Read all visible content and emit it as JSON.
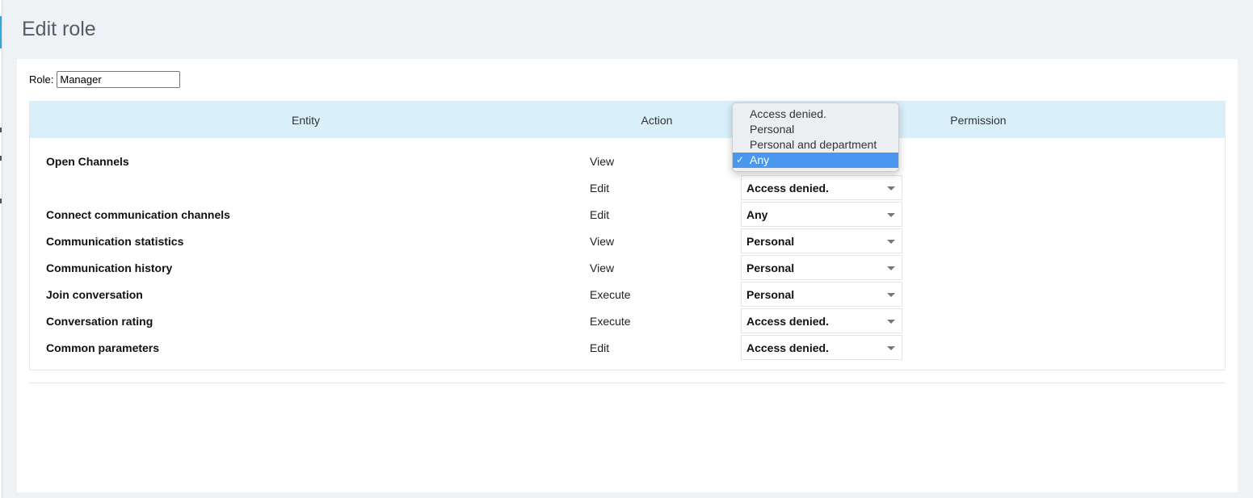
{
  "page": {
    "title": "Edit role"
  },
  "role": {
    "label": "Role:",
    "value": "Manager"
  },
  "table": {
    "headers": {
      "entity": "Entity",
      "action": "Action",
      "permission": "Permission"
    },
    "rows": [
      {
        "entity": "Open Channels",
        "action": "View",
        "permission": "Any"
      },
      {
        "entity": "",
        "action": "Edit",
        "permission": "Access denied."
      },
      {
        "entity": "Connect communication channels",
        "action": "Edit",
        "permission": "Any"
      },
      {
        "entity": "Communication statistics",
        "action": "View",
        "permission": "Personal"
      },
      {
        "entity": "Communication history",
        "action": "View",
        "permission": "Personal"
      },
      {
        "entity": "Join conversation",
        "action": "Execute",
        "permission": "Personal"
      },
      {
        "entity": "Conversation rating",
        "action": "Execute",
        "permission": "Access denied."
      },
      {
        "entity": "Common parameters",
        "action": "Edit",
        "permission": "Access denied."
      }
    ]
  },
  "dropdown": {
    "options": [
      "Access denied.",
      "Personal",
      "Personal and department",
      "Any"
    ],
    "selected": "Any",
    "check_glyph": "✓"
  },
  "colors": {
    "header_bg": "#d9eff9",
    "selected_option": "#4a97f0",
    "title": "#535c69"
  }
}
